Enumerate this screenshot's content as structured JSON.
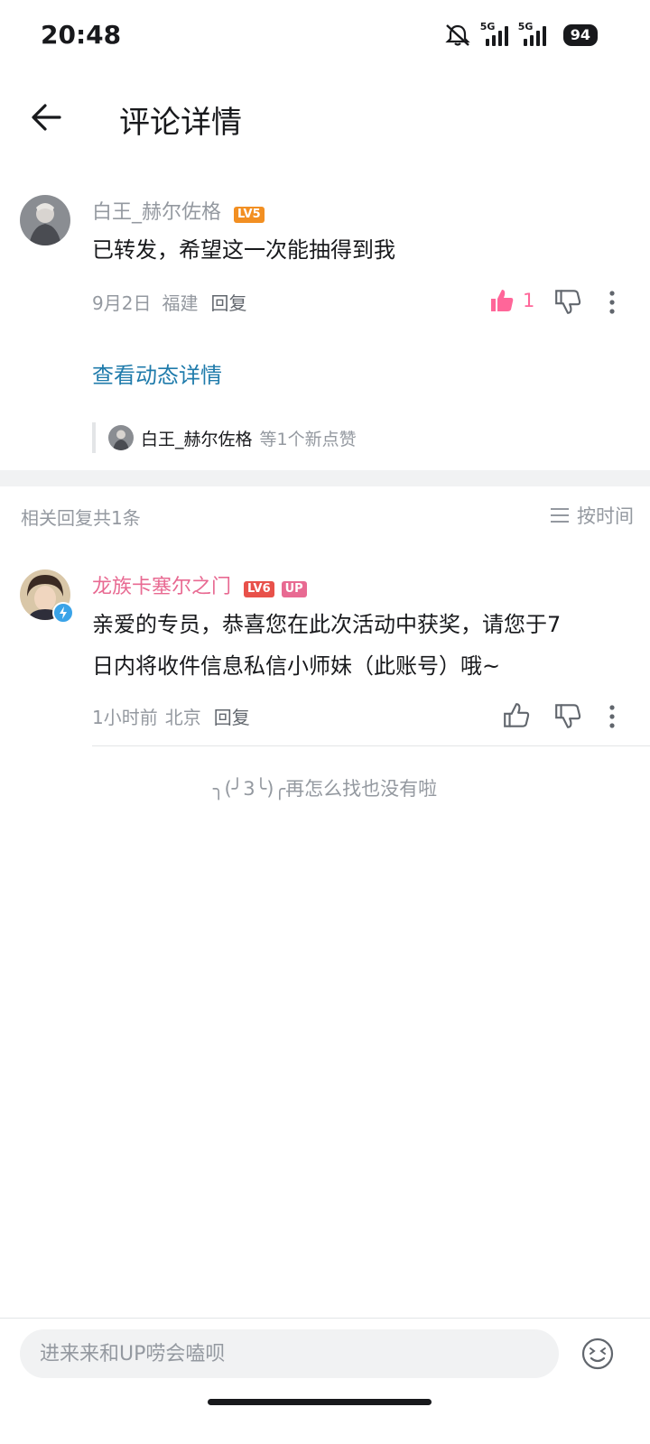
{
  "status_bar": {
    "time": "20:48",
    "network1": "5G",
    "network2": "5G",
    "battery": "94"
  },
  "header": {
    "title": "评论详情"
  },
  "main_comment": {
    "username": "白王_赫尔佐格",
    "level": "LV5",
    "level_color": "#f28f22",
    "text": "已转发，希望这一次能抽得到我",
    "date": "9月2日",
    "location": "福建",
    "reply_label": "回复",
    "like_count": "1",
    "like_color": "#ff6699",
    "view_post_link": "查看动态详情",
    "likes_user": "白王_赫尔佐格",
    "likes_suffix": "等1个新点赞"
  },
  "replies_header": {
    "count_text": "相关回复共1条",
    "sort_label": "按时间"
  },
  "reply": {
    "username": "龙族卡塞尔之门",
    "level": "LV6",
    "level_color": "#e8514a",
    "up_badge": "UP",
    "text_line1": "亲爱的专员，恭喜您在此次活动中获奖，请您于7",
    "text_line2": "日内将收件信息私信小师妹（此账号）哦~",
    "time": "1小时前",
    "location": "北京",
    "reply_label": "回复"
  },
  "end_text": "╮(╯3╰)╭再怎么找也没有啦",
  "input": {
    "placeholder": "进来来和UP唠会嗑呗"
  }
}
